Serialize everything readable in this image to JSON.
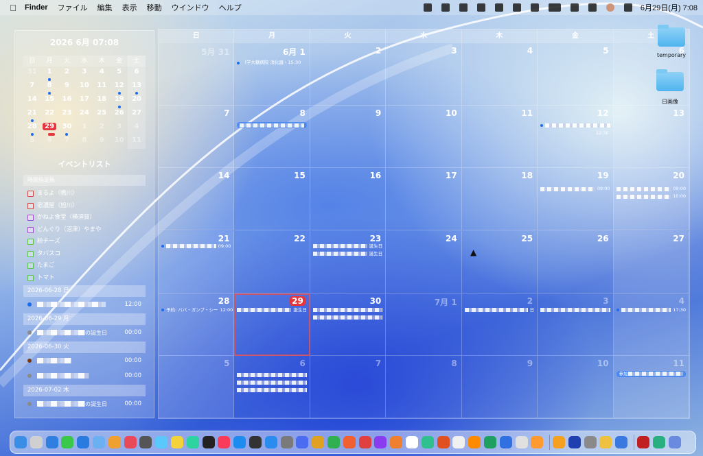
{
  "menubar": {
    "app_name": "Finder",
    "menus": [
      "ファイル",
      "編集",
      "表示",
      "移動",
      "ウインドウ",
      "ヘルプ"
    ],
    "clock": "6月29日(月)  7:08"
  },
  "sidebar": {
    "title": "2026 6月 07:08",
    "weekdays": [
      "日",
      "月",
      "火",
      "水",
      "木",
      "金",
      "土"
    ],
    "weeks": [
      [
        "31",
        "1",
        "2",
        "3",
        "4",
        "5",
        "6"
      ],
      [
        "7",
        "8",
        "9",
        "10",
        "11",
        "12",
        "13"
      ],
      [
        "14",
        "15",
        "16",
        "17",
        "18",
        "19",
        "20"
      ],
      [
        "21",
        "22",
        "23",
        "24",
        "25",
        "26",
        "27"
      ],
      [
        "28",
        "29",
        "30",
        "1",
        "2",
        "3",
        "4"
      ],
      [
        "5",
        "6",
        "7",
        "8",
        "9",
        "10",
        "11"
      ]
    ],
    "events_title": "イベントリスト",
    "untimed_header": "時間指定無",
    "tasks": [
      {
        "label": "まるよ（鴨川）",
        "color": "red"
      },
      {
        "label": "宿濃屋（旭川）",
        "color": "red"
      },
      {
        "label": "かねよ食堂（横須賀）",
        "color": "purple"
      },
      {
        "label": "どんぐり（沼津）やまや",
        "color": "purple"
      },
      {
        "label": "粉チーズ",
        "color": "green"
      },
      {
        "label": "タバスコ",
        "color": "green"
      },
      {
        "label": "たまご",
        "color": "green"
      },
      {
        "label": "トマト",
        "color": "green"
      }
    ],
    "days": [
      {
        "date": "2026-06-28 日",
        "events": [
          {
            "dot": "blue",
            "time": "12:00"
          }
        ]
      },
      {
        "date": "2026-06-29 月",
        "events": [
          {
            "dot": "gray",
            "text": "の誕生日",
            "time": "00:00"
          }
        ]
      },
      {
        "date": "2026-06-30 火",
        "events": [
          {
            "dot": "brown",
            "time": "00:00"
          },
          {
            "dot": "gray",
            "time": "00:00"
          }
        ]
      },
      {
        "date": "2026-07-02 木",
        "events": [
          {
            "dot": "gray",
            "text": "の誕生日",
            "time": "00:00"
          }
        ]
      }
    ]
  },
  "calendar": {
    "weekdays": [
      "日",
      "月",
      "火",
      "水",
      "木",
      "金",
      "土"
    ],
    "today_label": "29",
    "cells": [
      "5月 31",
      "6月 1",
      "2",
      "3",
      "4",
      "5",
      "6",
      "7",
      "8",
      "9",
      "10",
      "11",
      "12",
      "13",
      "14",
      "15",
      "16",
      "17",
      "18",
      "19",
      "20",
      "21",
      "22",
      "23",
      "24",
      "25",
      "26",
      "27",
      "28",
      "29",
      "30",
      "7月 1",
      "2",
      "3",
      "4",
      "5",
      "6",
      "7",
      "8",
      "9",
      "10",
      "11"
    ],
    "event_texts": {
      "jun1": "（学大糖病院 消化器・15:30",
      "jun12_time": "12:30",
      "jun19_time": "09:00",
      "jun20_time1": "09:00",
      "jun20_time2": "10:00",
      "jun21_time": "09:00",
      "jun23_a": "誕生日",
      "jun23_b": "誕生日",
      "jun28": "予約: ババ・ガンプ・シー",
      "jun28_time": "12:00",
      "jun29": "誕生日",
      "jul2": "日",
      "jul4_time": "17:30",
      "jul11": "参加"
    }
  },
  "desktop": {
    "items": [
      {
        "label": "temporary"
      },
      {
        "label": "日画像"
      }
    ]
  },
  "colors": {
    "accent": "#1d6cf0",
    "today": "#e5363d"
  }
}
